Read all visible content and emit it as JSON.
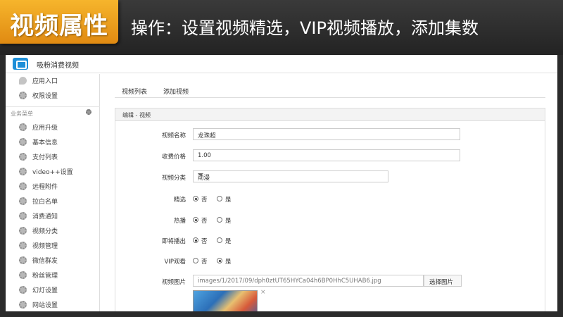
{
  "banner": {
    "badge": "视频属性",
    "description": "操作：设置视频精选，VIP视频播放，添加集数"
  },
  "app": {
    "title": "吸粉消费视频"
  },
  "sidebar": {
    "top_items": [
      {
        "label": "应用入口",
        "icon": "chat-bubble-icon"
      },
      {
        "label": "权限设置",
        "icon": "gear-icon"
      }
    ],
    "section_label": "业务菜单",
    "items": [
      {
        "label": "应用升级",
        "icon": "gear-icon"
      },
      {
        "label": "基本信息",
        "icon": "gear-icon"
      },
      {
        "label": "支付列表",
        "icon": "gear-icon"
      },
      {
        "label": "video++设置",
        "icon": "gear-icon"
      },
      {
        "label": "远程附件",
        "icon": "gear-icon"
      },
      {
        "label": "拉白名单",
        "icon": "gear-icon"
      },
      {
        "label": "消费通知",
        "icon": "gear-icon"
      },
      {
        "label": "视频分类",
        "icon": "gear-icon"
      },
      {
        "label": "视频管理",
        "icon": "gear-icon"
      },
      {
        "label": "微信群发",
        "icon": "gear-icon"
      },
      {
        "label": "粉丝管理",
        "icon": "gear-icon"
      },
      {
        "label": "幻灯设置",
        "icon": "gear-icon"
      },
      {
        "label": "网站设置",
        "icon": "gear-icon"
      }
    ]
  },
  "tabs": [
    {
      "label": "视频列表"
    },
    {
      "label": "添加视频"
    }
  ],
  "panel": {
    "title": "编辑 - 视频"
  },
  "form": {
    "name": {
      "label": "视频名称",
      "value": "龙珠超"
    },
    "price": {
      "label": "收费价格",
      "value": "1.00"
    },
    "category": {
      "label": "视频分类",
      "value": "动漫"
    },
    "featured": {
      "label": "精选",
      "options": [
        "否",
        "是"
      ],
      "selected": "否"
    },
    "hot": {
      "label": "热播",
      "options": [
        "否",
        "是"
      ],
      "selected": "否"
    },
    "upcoming": {
      "label": "即将播出",
      "options": [
        "否",
        "是"
      ],
      "selected": "否"
    },
    "vip": {
      "label": "VIP观看",
      "options": [
        "否",
        "是"
      ],
      "selected": "是"
    },
    "image": {
      "label": "视频图片",
      "path": "images/1/2017/09/dph0ztUT65HYCa04h6BP0HhC5UHAB6.jpg",
      "button": "选择图片",
      "remove": "×"
    }
  }
}
